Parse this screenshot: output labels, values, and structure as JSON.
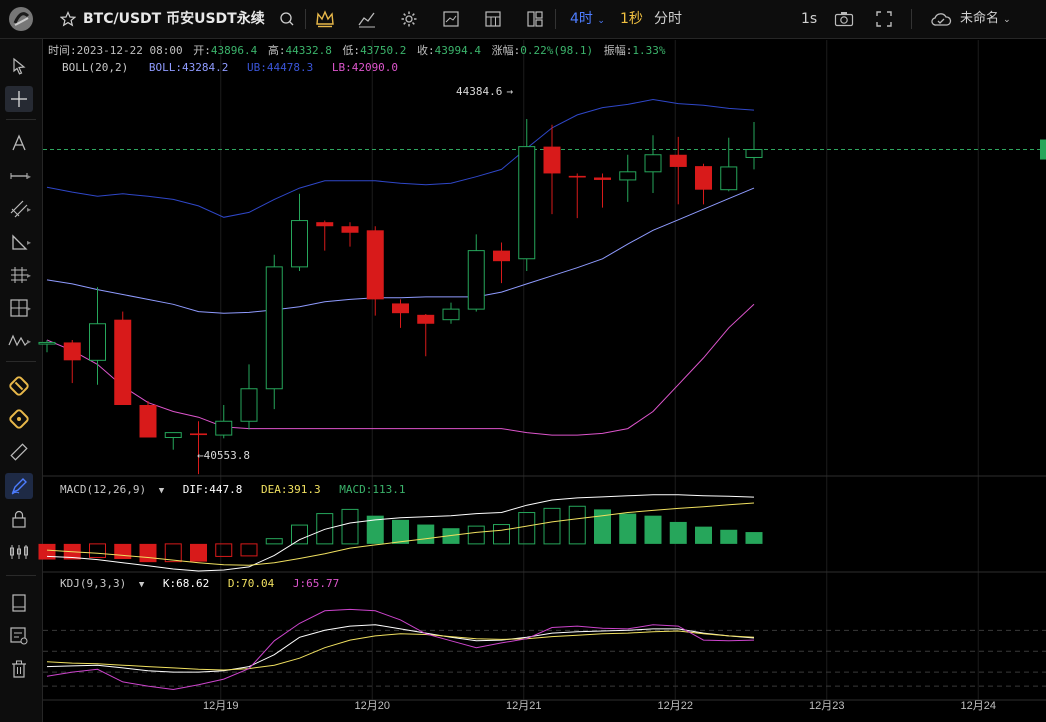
{
  "topbar": {
    "symbol": "BTC/USDT 币安USDT永续",
    "interval": "4时",
    "interval2": "1秒",
    "interval3": "分时",
    "refresh": "1s",
    "save_name": "未命名"
  },
  "ohlc_info": {
    "time_label": "时间:",
    "time": "2023-12-22 08:00",
    "open_label": "开:",
    "open": "43896.4",
    "high_label": "高:",
    "high": "44332.8",
    "low_label": "低:",
    "low": "43750.2",
    "close_label": "收:",
    "close": "43994.4",
    "change_label": "涨幅:",
    "change": "0.22%(98.1)",
    "amp_label": "振幅:",
    "amp": "1.33%"
  },
  "boll_legend": {
    "name": "BOLL(20,2)",
    "mid": "BOLL:43284.2",
    "ub": "UB:44478.3",
    "lb": "LB:42090.0"
  },
  "macd_legend": {
    "name": "MACD(12,26,9)",
    "dif": "DIF:447.8",
    "dea": "DEA:391.3",
    "macd": "MACD:113.1"
  },
  "kdj_legend": {
    "name": "KDJ(9,3,3)",
    "k": "K:68.62",
    "d": "D:70.04",
    "j": "J:65.77"
  },
  "annotations": {
    "high_mark": "44384.6",
    "low_mark": "40553.8"
  },
  "chart_data": {
    "type": "candlestick",
    "x_ticks": [
      "12月19",
      "12月20",
      "12月21",
      "12月22",
      "12月23",
      "12月24"
    ],
    "candles": [
      {
        "o": 41600,
        "h": 41650,
        "l": 41500,
        "c": 41620
      },
      {
        "o": 41620,
        "h": 41650,
        "l": 41120,
        "c": 41400
      },
      {
        "o": 41400,
        "h": 42300,
        "l": 41100,
        "c": 41850
      },
      {
        "o": 41900,
        "h": 42000,
        "l": 40900,
        "c": 40850
      },
      {
        "o": 40850,
        "h": 40900,
        "l": 40500,
        "c": 40450
      },
      {
        "o": 40450,
        "h": 40500,
        "l": 40300,
        "c": 40510
      },
      {
        "o": 40500,
        "h": 40650,
        "l": 40000,
        "c": 40480
      },
      {
        "o": 40480,
        "h": 40850,
        "l": 40440,
        "c": 40650
      },
      {
        "o": 40650,
        "h": 41350,
        "l": 40550,
        "c": 41050
      },
      {
        "o": 41050,
        "h": 42700,
        "l": 40800,
        "c": 42550
      },
      {
        "o": 42550,
        "h": 43450,
        "l": 42500,
        "c": 43120
      },
      {
        "o": 43100,
        "h": 43120,
        "l": 42750,
        "c": 43050
      },
      {
        "o": 43050,
        "h": 43100,
        "l": 42800,
        "c": 42970
      },
      {
        "o": 43000,
        "h": 43050,
        "l": 41950,
        "c": 42150
      },
      {
        "o": 42100,
        "h": 42150,
        "l": 41800,
        "c": 41980
      },
      {
        "o": 41960,
        "h": 41970,
        "l": 41450,
        "c": 41850
      },
      {
        "o": 41900,
        "h": 42110,
        "l": 41850,
        "c": 42030
      },
      {
        "o": 42030,
        "h": 42950,
        "l": 42000,
        "c": 42750
      },
      {
        "o": 42750,
        "h": 42850,
        "l": 42350,
        "c": 42620
      },
      {
        "o": 42650,
        "h": 44370,
        "l": 42500,
        "c": 44030
      },
      {
        "o": 44030,
        "h": 44300,
        "l": 43200,
        "c": 43700
      },
      {
        "o": 43670,
        "h": 43700,
        "l": 43150,
        "c": 43650
      },
      {
        "o": 43650,
        "h": 43700,
        "l": 43280,
        "c": 43620
      },
      {
        "o": 43620,
        "h": 43930,
        "l": 43350,
        "c": 43720
      },
      {
        "o": 43720,
        "h": 44170,
        "l": 43460,
        "c": 43930
      },
      {
        "o": 43930,
        "h": 44150,
        "l": 43320,
        "c": 43780
      },
      {
        "o": 43790,
        "h": 43820,
        "l": 43320,
        "c": 43500
      },
      {
        "o": 43500,
        "h": 44140,
        "l": 43480,
        "c": 43780
      },
      {
        "o": 43896.4,
        "h": 44332.8,
        "l": 43750.2,
        "c": 43994.4
      }
    ],
    "boll_mid": [
      42390,
      42340,
      42270,
      42210,
      42150,
      42090,
      42000,
      41980,
      41990,
      42020,
      42060,
      42120,
      42150,
      42170,
      42170,
      42180,
      42180,
      42180,
      42240,
      42340,
      42440,
      42540,
      42650,
      42830,
      43000,
      43130,
      43260,
      43390,
      43520
    ],
    "boll_ub": [
      43530,
      43470,
      43420,
      43450,
      43420,
      43380,
      43300,
      43160,
      43220,
      43380,
      43520,
      43610,
      43610,
      43610,
      43580,
      43560,
      43580,
      43660,
      43750,
      44010,
      44260,
      44420,
      44510,
      44550,
      44610,
      44560,
      44540,
      44500,
      44480
    ],
    "boll_lb": [
      41650,
      41520,
      41350,
      41080,
      40880,
      40770,
      40700,
      40580,
      40560,
      40560,
      40560,
      40560,
      40560,
      40560,
      40560,
      40560,
      40560,
      40560,
      40560,
      40510,
      40480,
      40480,
      40500,
      40560,
      40770,
      41100,
      41430,
      41800,
      42090
    ],
    "macd_hist": [
      -150,
      -150,
      -130,
      -145,
      -175,
      -170,
      -170,
      -120,
      -115,
      50,
      180,
      290,
      330,
      270,
      230,
      185,
      150,
      170,
      185,
      300,
      340,
      360,
      330,
      290,
      270,
      210,
      165,
      135,
      113
    ],
    "dif": [
      -120,
      -130,
      -150,
      -180,
      -210,
      -240,
      -260,
      -250,
      -220,
      -110,
      40,
      140,
      200,
      230,
      250,
      260,
      270,
      290,
      300,
      370,
      420,
      440,
      450,
      460,
      470,
      470,
      460,
      455,
      448
    ],
    "dea": [
      -60,
      -75,
      -90,
      -110,
      -130,
      -155,
      -180,
      -200,
      -205,
      -180,
      -140,
      -95,
      -40,
      -10,
      20,
      50,
      80,
      110,
      130,
      170,
      210,
      240,
      270,
      300,
      320,
      340,
      355,
      375,
      391
    ],
    "kdj_k": [
      28,
      29,
      30,
      26,
      22,
      20,
      20,
      22,
      28,
      45,
      70,
      80,
      86,
      88,
      82,
      76,
      70,
      65,
      66,
      70,
      76,
      78,
      79,
      80,
      82,
      82,
      76,
      72,
      69
    ],
    "kdj_d": [
      35,
      33,
      32,
      30,
      28,
      26,
      24,
      23,
      25,
      30,
      40,
      55,
      66,
      72,
      75,
      74,
      71,
      68,
      67,
      68,
      71,
      73,
      75,
      76,
      78,
      79,
      75,
      72,
      70
    ],
    "kdj_j": [
      14,
      20,
      24,
      6,
      0,
      -5,
      2,
      10,
      25,
      65,
      90,
      108,
      110,
      108,
      95,
      75,
      65,
      55,
      62,
      68,
      84,
      86,
      83,
      82,
      88,
      86,
      66,
      65,
      66
    ],
    "ylim_price": [
      40050,
      44850
    ],
    "ylim_macd": [
      -250,
      420
    ],
    "ylim_kdj": [
      -20,
      135
    ],
    "kdj_levels": [
      80,
      50,
      20,
      0
    ]
  },
  "colors": {
    "up": "#26a65b",
    "down": "#d81a1a",
    "mid": "#8f9bff",
    "ub": "#2f47c8",
    "lb": "#dd55cc",
    "dif": "#ffffff",
    "dea": "#f0e060",
    "j": "#cc44cc",
    "accent": "#4d7dff"
  }
}
